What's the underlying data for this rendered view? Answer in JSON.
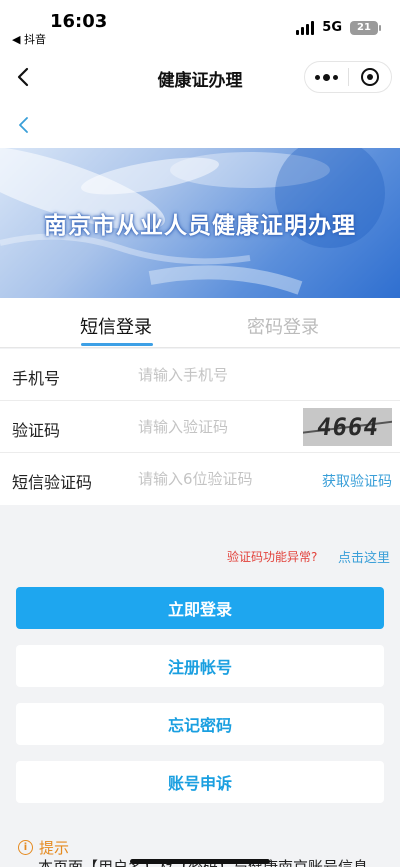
{
  "status_bar": {
    "time": "16:03",
    "back_app": "◀ 抖音",
    "network": "5G",
    "battery": "21"
  },
  "nav": {
    "title": "健康证办理"
  },
  "banner": {
    "title": "南京市从业人员健康证明办理"
  },
  "tabs": [
    {
      "label": "短信登录",
      "active": true
    },
    {
      "label": "密码登录",
      "active": false
    }
  ],
  "form": {
    "phone": {
      "label": "手机号",
      "placeholder": "请输入手机号",
      "value": ""
    },
    "captcha": {
      "label": "验证码",
      "placeholder": "请输入验证码",
      "value": "",
      "image_text": "4664"
    },
    "sms_code": {
      "label": "短信验证码",
      "placeholder": "请输入6位验证码",
      "value": "",
      "get_code_label": "获取验证码"
    }
  },
  "help": {
    "error_text": "验证码功能异常?",
    "link_text": "点击这里"
  },
  "buttons": {
    "login": "立即登录",
    "register": "注册帐号",
    "forgot": "忘记密码",
    "appeal": "账号申诉"
  },
  "tip": {
    "label": "提示",
    "text": "本页面【用户名】及【密码】与健康南京账号信息"
  },
  "colors": {
    "accent": "#1ea6ef",
    "link": "#3a9fd8",
    "error": "#e2423b",
    "warning": "#e58a1f"
  },
  "icons": {
    "nav_back": "chevron-left-icon",
    "page_back": "chevron-left-icon",
    "more": "more-dots-icon",
    "close": "close-mini-program-icon",
    "tip": "info-icon"
  }
}
